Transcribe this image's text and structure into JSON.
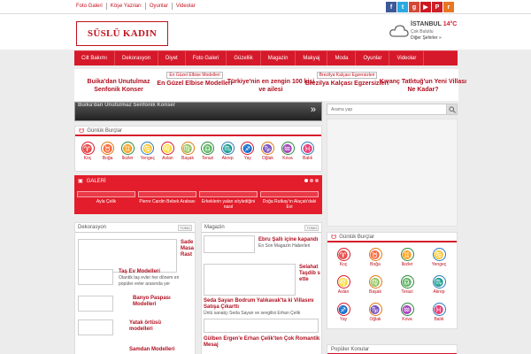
{
  "topbar": {
    "links": [
      "Foto Galeri",
      "Köşe Yazıları",
      "Oyunlar",
      "Videolar"
    ],
    "social": [
      {
        "name": "facebook-icon",
        "glyph": "f",
        "color": "#3b5998"
      },
      {
        "name": "twitter-icon",
        "glyph": "t",
        "color": "#2aa9e0"
      },
      {
        "name": "google-plus-icon",
        "glyph": "g",
        "color": "#d34836"
      },
      {
        "name": "youtube-icon",
        "glyph": "▶",
        "color": "#cc181e"
      },
      {
        "name": "pinterest-icon",
        "glyph": "P",
        "color": "#cb2027"
      },
      {
        "name": "rss-icon",
        "glyph": "r",
        "color": "#e87722"
      }
    ]
  },
  "logo": {
    "text": "SÜSLÜ KADIN"
  },
  "weather": {
    "city": "İSTANBUL",
    "temp": "14°C",
    "condition": "Çok Bulutlu",
    "other": "Diğer Şehirler »"
  },
  "nav": [
    "Cilt Bakımı",
    "Dekorasyon",
    "Diyet",
    "Foto Galeri",
    "Güzellik",
    "Magazin",
    "Makyaj",
    "Moda",
    "Oyunlar",
    "Videolar"
  ],
  "headlines": [
    {
      "tag": "",
      "title": "Buika'dan Unutulmaz Senfonik Konser"
    },
    {
      "tag": "En Güzel Elbise Modelleri",
      "title": "En Güzel Elbise Modelleri"
    },
    {
      "tag": "",
      "title": "Türkiye'nin en zengin 100 kişi ve ailesi"
    },
    {
      "tag": "Brezilya Kalçası Egzersizleri",
      "title": "Brezilya Kalçası Egzersizleri"
    },
    {
      "tag": "",
      "title": "Kıvanç Tatlıtuğ'un Yeni Villası Ne Kadar?"
    }
  ],
  "slider": {
    "text": "Buika'dan Unutulmaz Senfonik Konser"
  },
  "search": {
    "placeholder": "Arama yap"
  },
  "horoscope": {
    "title": "Günlük Burçlar",
    "signs": [
      {
        "label": "Koç",
        "glyph": "♈",
        "color": "#d5192a"
      },
      {
        "label": "Boğa",
        "glyph": "♉",
        "color": "#e07a10"
      },
      {
        "label": "İkizler",
        "glyph": "♊",
        "color": "#2a8a3a"
      },
      {
        "label": "Yengeç",
        "glyph": "♋",
        "color": "#2a7ab8"
      },
      {
        "label": "Aslan",
        "glyph": "♌",
        "color": "#d5192a"
      },
      {
        "label": "Başak",
        "glyph": "♍",
        "color": "#e07a10"
      },
      {
        "label": "Terazi",
        "glyph": "♎",
        "color": "#2a8a3a"
      },
      {
        "label": "Akrep",
        "glyph": "♏",
        "color": "#2a7ab8"
      },
      {
        "label": "Yay",
        "glyph": "♐",
        "color": "#d5192a"
      },
      {
        "label": "Oğlak",
        "glyph": "♑",
        "color": "#e07a10"
      },
      {
        "label": "Kova",
        "glyph": "♒",
        "color": "#2a8a3a"
      },
      {
        "label": "Balık",
        "glyph": "♓",
        "color": "#2a7ab8"
      }
    ]
  },
  "gallery": {
    "title": "GALERİ",
    "items": [
      "Ayla Çelik",
      "Pierre Cardin Bebek Arabası",
      "Erkeklerin yalan söylediğini nasıl",
      "Doğa Rutkay'ın Alaçatı'daki Evi"
    ]
  },
  "dekorasyon": {
    "title": "Dekorasyon",
    "more": "TÜMÜ",
    "featured": "Sade Masa Rast",
    "articles": [
      {
        "title": "Taş Ev Modelleri",
        "desc": "Otantik taş evler her dönem en popüler evler arasında yer"
      },
      {
        "title": "Banyo Paspası Modelleri",
        "desc": ""
      },
      {
        "title": "Yatak örtüsü modelleri",
        "desc": ""
      },
      {
        "title": "Samdan Modelleri",
        "desc": ""
      }
    ]
  },
  "magazin": {
    "title": "Magazin",
    "more": "TÜMÜ",
    "articles": [
      {
        "title": "Ebru Şallı içine kapandı",
        "desc": "En Son Magazin Haberleri"
      },
      {
        "title": "Selahat Taşdib sette",
        "desc": ""
      },
      {
        "title": "Seda Sayan Bodrum Yalıkavak'ta ki Villasını Satışa Çıkarttı",
        "desc": "Ünlü sanatçı Seda Sayan ve sevgilisi Erhan Çelik"
      },
      {
        "title": "Gülben Ergen'e Erhan Çelik'ten Çok Romantik Mesaj",
        "desc": ""
      }
    ]
  },
  "sidebar_horoscope": {
    "title": "Günlük Burçlar"
  },
  "popular": {
    "title": "Popüler Konular"
  }
}
